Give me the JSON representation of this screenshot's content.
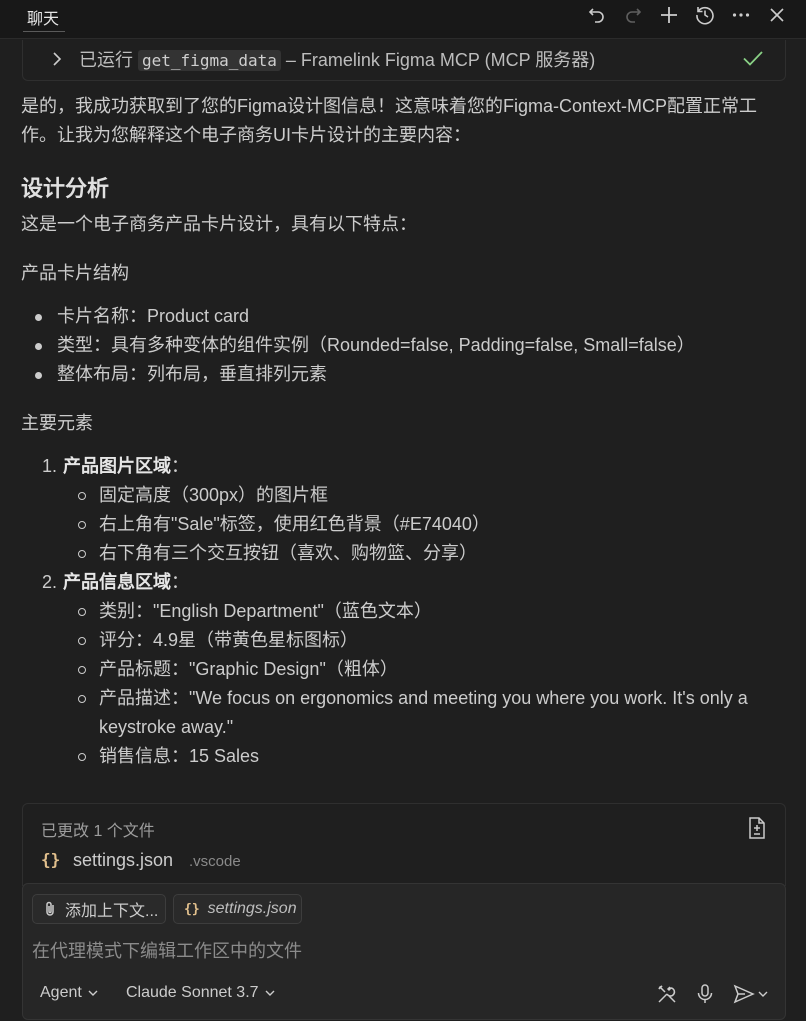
{
  "header": {
    "title": "聊天"
  },
  "tool_run": {
    "prefix": "已运行",
    "tool_name": "get_figma_data",
    "suffix": " – Framelink Figma MCP (MCP 服务器)"
  },
  "message": {
    "intro": "是的，我成功获取到了您的Figma设计图信息！这意味着您的Figma-Context-MCP配置正常工作。让我为您解释这个电子商务UI卡片设计的主要内容：",
    "heading": "设计分析",
    "lead": "这是一个电子商务产品卡片设计，具有以下特点：",
    "section1_title": "产品卡片结构",
    "section1_items": [
      "卡片名称：Product card",
      "类型：具有多种变体的组件实例（Rounded=false, Padding=false, Small=false）",
      "整体布局：列布局，垂直排列元素"
    ],
    "section2_title": "主要元素",
    "ordered": [
      {
        "num": "1.",
        "title": "产品图片区域",
        "colon": "：",
        "items": [
          "固定高度（300px）的图片框",
          "右上角有\"Sale\"标签，使用红色背景（#E74040）",
          "右下角有三个交互按钮（喜欢、购物篮、分享）"
        ]
      },
      {
        "num": "2.",
        "title": "产品信息区域",
        "colon": "：",
        "items": [
          "类别：\"English Department\"（蓝色文本）",
          "评分：4.9星（带黄色星标图标）",
          "产品标题：\"Graphic Design\"（粗体）",
          "产品描述：\"We focus on ergonomics and meeting you where you work. It's only a keystroke away.\"",
          "销售信息：15 Sales"
        ]
      }
    ]
  },
  "changed_files": {
    "label": "已更改 1 个文件",
    "file_name": "settings.json",
    "file_dir": ".vscode"
  },
  "input": {
    "chip_add_context": "添加上下文...",
    "chip_file": "settings.json",
    "placeholder": "在代理模式下编辑工作区中的文件",
    "mode": "Agent",
    "model": "Claude Sonnet 3.7"
  },
  "colors": {
    "background": "#1f1f1f",
    "check": "#89d185",
    "json_icon": "#e2c08d"
  }
}
